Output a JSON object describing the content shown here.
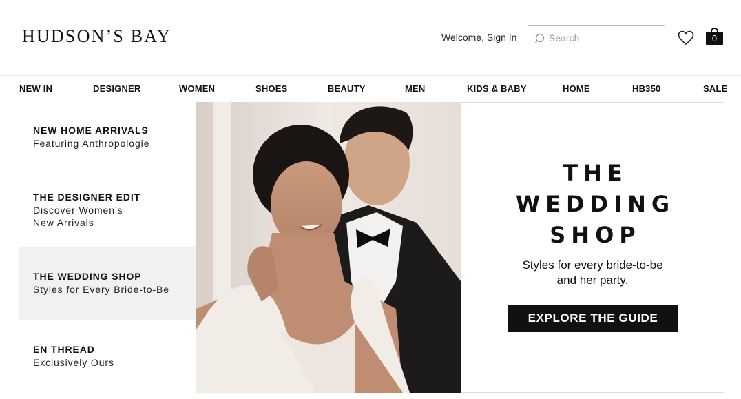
{
  "header": {
    "logo": "HUDSON’S BAY",
    "welcome": "Welcome, Sign In",
    "search_placeholder": "Search",
    "bag_count": "0"
  },
  "nav": {
    "items": [
      "NEW IN",
      "DESIGNER",
      "WOMEN",
      "SHOES",
      "BEAUTY",
      "MEN",
      "KIDS & BABY",
      "HOME",
      "HB350",
      "SALE"
    ]
  },
  "features": [
    {
      "title": "NEW HOME ARRIVALS",
      "lines": [
        "Featuring Anthropologie"
      ]
    },
    {
      "title": "THE DESIGNER EDIT",
      "lines": [
        "Discover Women’s",
        "New Arrivals"
      ]
    },
    {
      "title": "THE WEDDING SHOP",
      "lines": [
        "Styles for Every Bride-to-Be"
      ],
      "active": true
    },
    {
      "title": "EN THREAD",
      "lines": [
        "Exclusively Ours"
      ]
    }
  ],
  "promo": {
    "title_lines": [
      "THE",
      "WEDDING",
      "SHOP"
    ],
    "subtitle_lines": [
      "Styles for every bride-to-be",
      "and her party."
    ],
    "cta": "EXPLORE THE GUIDE"
  },
  "colors": {
    "text": "#111111",
    "active_feature_bg": "#f1f1f1",
    "cta_bg": "#111111",
    "cta_text": "#ffffff"
  },
  "icons": {
    "search": "search-icon",
    "wishlist": "heart-icon",
    "bag": "shopping-bag-icon"
  }
}
